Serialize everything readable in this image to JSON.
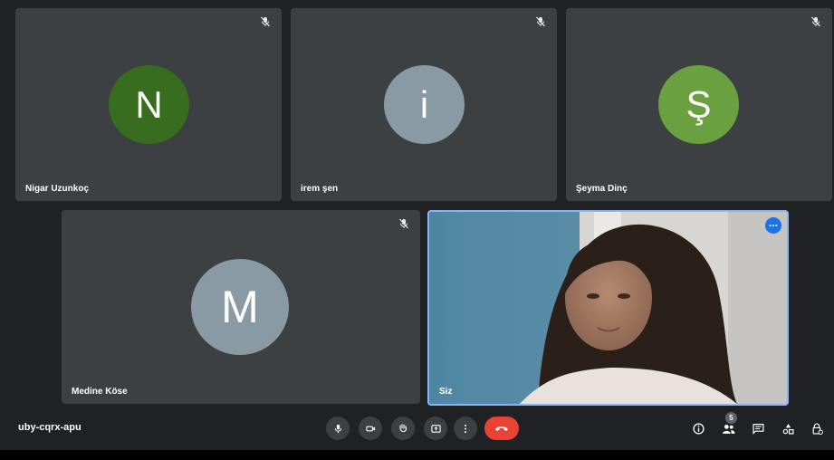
{
  "participants": [
    {
      "name": "Nigar Uzunkoç",
      "initial": "N",
      "color": "#386c1f",
      "muted": true
    },
    {
      "name": "irem şen",
      "initial": "i",
      "color": "#8a9aa5",
      "muted": true
    },
    {
      "name": "Şeyma Dinç",
      "initial": "Ş",
      "color": "#6aa040",
      "muted": true
    },
    {
      "name": "Medine Köse",
      "initial": "M",
      "color": "#8a9aa5",
      "muted": true
    }
  ],
  "self_view": {
    "name": "Siz"
  },
  "meeting": {
    "code": "uby-cqrx-apu"
  },
  "controls": [
    "mic-icon",
    "camera-icon",
    "raise-hand-icon",
    "present-screen-icon",
    "more-options-icon",
    "hang-up-icon"
  ],
  "right_controls": {
    "people_count": "5",
    "icons": [
      "info-icon",
      "people-icon",
      "chat-icon",
      "activities-icon",
      "host-controls-icon"
    ]
  },
  "colors": {
    "background": "#202124",
    "tile": "#3c4043",
    "hangup": "#ea4335",
    "accent": "#1a73e8",
    "self_border": "#8ab4f8"
  }
}
